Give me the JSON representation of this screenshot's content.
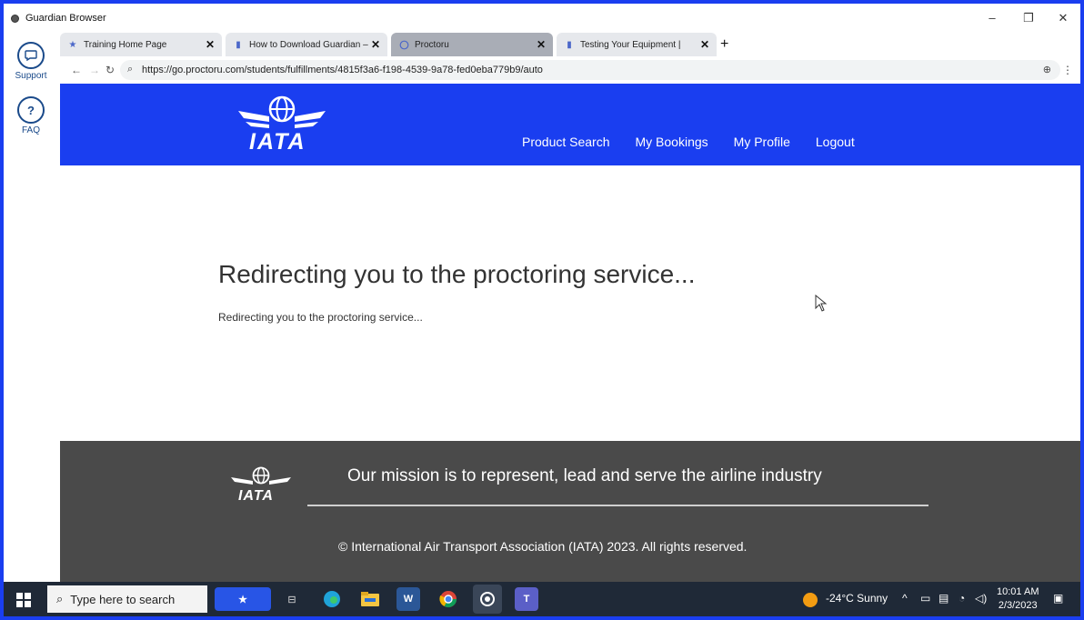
{
  "window": {
    "title": "Guardian Browser",
    "controls": {
      "minimize": "–",
      "restore": "❐",
      "close": "✕"
    }
  },
  "guardian_sidebar": {
    "items": [
      {
        "label": "Support",
        "icon": "chat-bubble-icon"
      },
      {
        "label": "FAQ",
        "icon": "question-icon"
      }
    ]
  },
  "tabs": [
    {
      "label": "Training Home Page",
      "icon": "iata-star-icon",
      "active": false
    },
    {
      "label": "How to Download Guardian –",
      "icon": "bookmark-tag-icon",
      "active": false
    },
    {
      "label": "Proctoru",
      "icon": "loading-circle-icon",
      "active": true
    },
    {
      "label": "Testing Your Equipment |",
      "icon": "bookmark-tag-icon",
      "active": false
    }
  ],
  "new_tab_label": "+",
  "address_bar": {
    "url": "https://go.proctoru.com/students/fulfillments/4815f3a6-f198-4539-9a78-fed0eba779b9/auto"
  },
  "site": {
    "logo_text": "IATA",
    "nav": [
      "Product Search",
      "My Bookings",
      "My Profile",
      "Logout"
    ],
    "heading": "Redirecting you to the proctoring service...",
    "message": "Redirecting you to the proctoring service...",
    "footer": {
      "logo_text": "IATA",
      "mission": "Our mission is to represent, lead and serve the airline industry",
      "copyright": "© International Air Transport Association (IATA) 2023. All rights reserved."
    }
  },
  "taskbar": {
    "search_placeholder": "Type here to search",
    "weather": "-24°C  Sunny",
    "time": "10:01 AM",
    "date": "2/3/2023"
  },
  "colors": {
    "iata_blue": "#1a3ef0",
    "footer_gray": "#4a4a4a",
    "taskbar": "#1f2937"
  }
}
